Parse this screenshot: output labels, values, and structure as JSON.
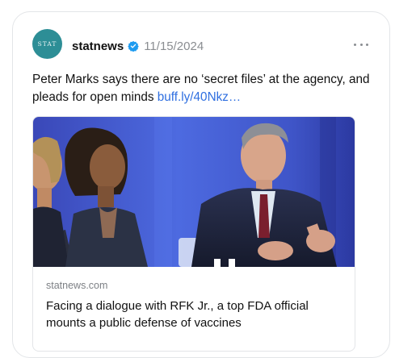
{
  "post": {
    "avatar_text": "STAT",
    "author": "statnews",
    "verified_icon": "verified-badge-icon",
    "date": "11/15/2024",
    "more_icon": "more-horizontal-icon",
    "text": "Peter Marks says there are no ‘secret files’ at the agency, and pleads for open minds ",
    "link_text": "buff.ly/40Nkz…"
  },
  "link_card": {
    "domain": "statnews.com",
    "title": "Facing a dialogue with RFK Jr., a top FDA official mounts a public defense of vaccines"
  },
  "colors": {
    "accent": "#2f6fe0",
    "avatar_bg": "#2d8e96",
    "verified": "#1d9bf0",
    "muted": "#8a8d91"
  }
}
